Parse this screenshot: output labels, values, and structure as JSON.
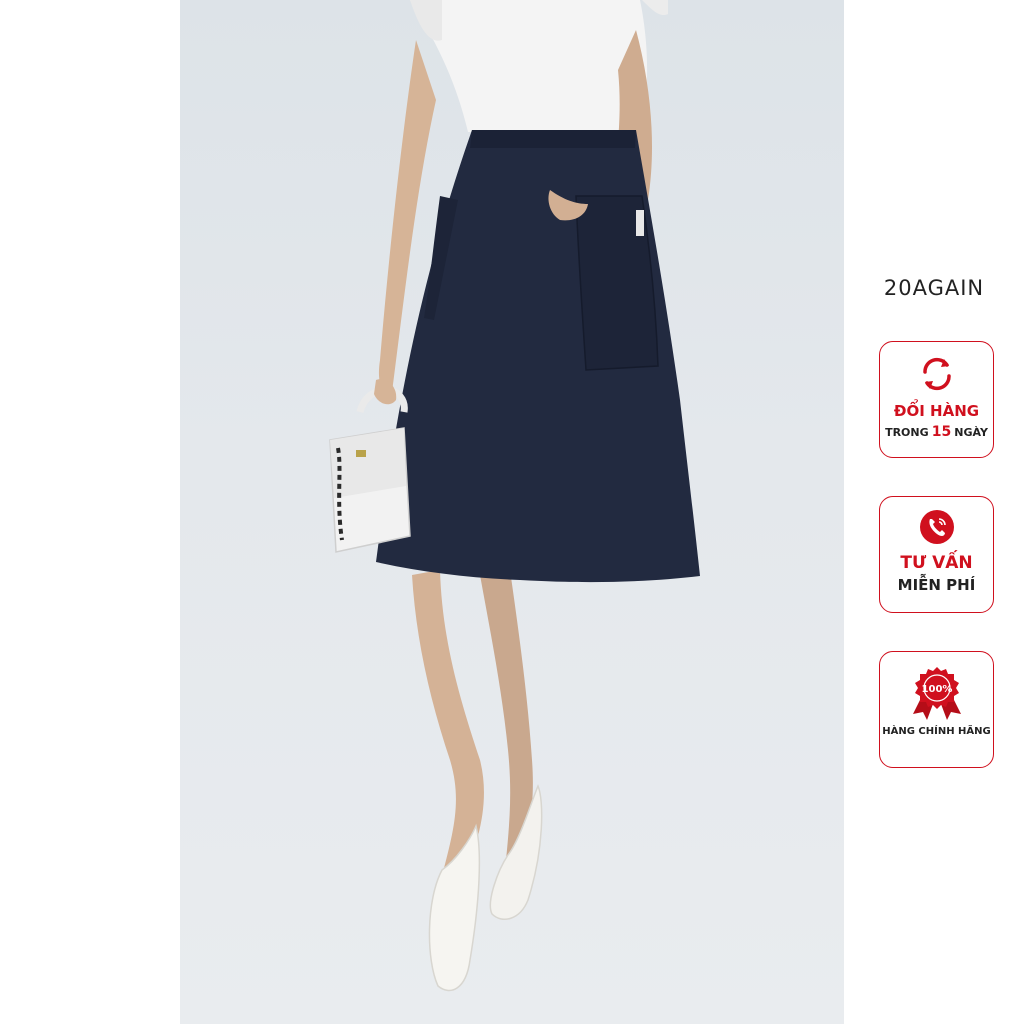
{
  "brand": {
    "name": "20AGAIN"
  },
  "badges": [
    {
      "line1": "ĐỔI HÀNG",
      "line2_prefix": "TRONG",
      "line2_number": "15",
      "line2_suffix": "NGÀY",
      "icon": "refresh-icon"
    },
    {
      "line1": "TƯ VẤN",
      "line2": "MIỄN PHÍ",
      "icon": "phone-icon"
    },
    {
      "seal_text": "100%",
      "line1": "HÀNG CHÍNH HÃNG",
      "icon": "ribbon-seal-icon"
    }
  ],
  "colors": {
    "accent": "#d0101e",
    "skirt": "#222a40",
    "background": "#e4e8ec"
  }
}
